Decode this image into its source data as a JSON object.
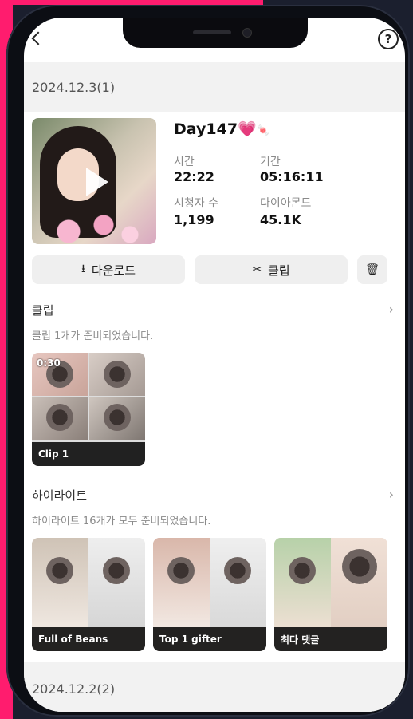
{
  "session": {
    "date_header": "2024.12.3(1)",
    "title": "Day147",
    "title_heart": "💗",
    "title_emoji": "🍬",
    "stats": [
      {
        "label": "시간",
        "value": "22:22"
      },
      {
        "label": "기간",
        "value": "05:16:11"
      },
      {
        "label": "시청자 수",
        "value": "1,199"
      },
      {
        "label": "다이아몬드",
        "value": "45.1K"
      }
    ]
  },
  "actions": {
    "download_label": "다운로드",
    "clip_label": "클립"
  },
  "clips": {
    "section_title": "클립",
    "subtitle": "클립 1개가 준비되었습니다.",
    "items": [
      {
        "label": "Clip 1",
        "time_badge": "0:30"
      }
    ]
  },
  "highlights": {
    "section_title": "하이라이트",
    "subtitle": "하이라이트 16개가 모두 준비되었습니다.",
    "items": [
      {
        "label": "Full of Beans"
      },
      {
        "label": "Top 1 gifter"
      },
      {
        "label": "최다 댓글"
      }
    ]
  },
  "next_session": {
    "date_header": "2024.12.2(2)"
  },
  "colors": {
    "accent": "#ff1c6e",
    "button_bg": "#efefef",
    "label_bar": "#000000"
  }
}
